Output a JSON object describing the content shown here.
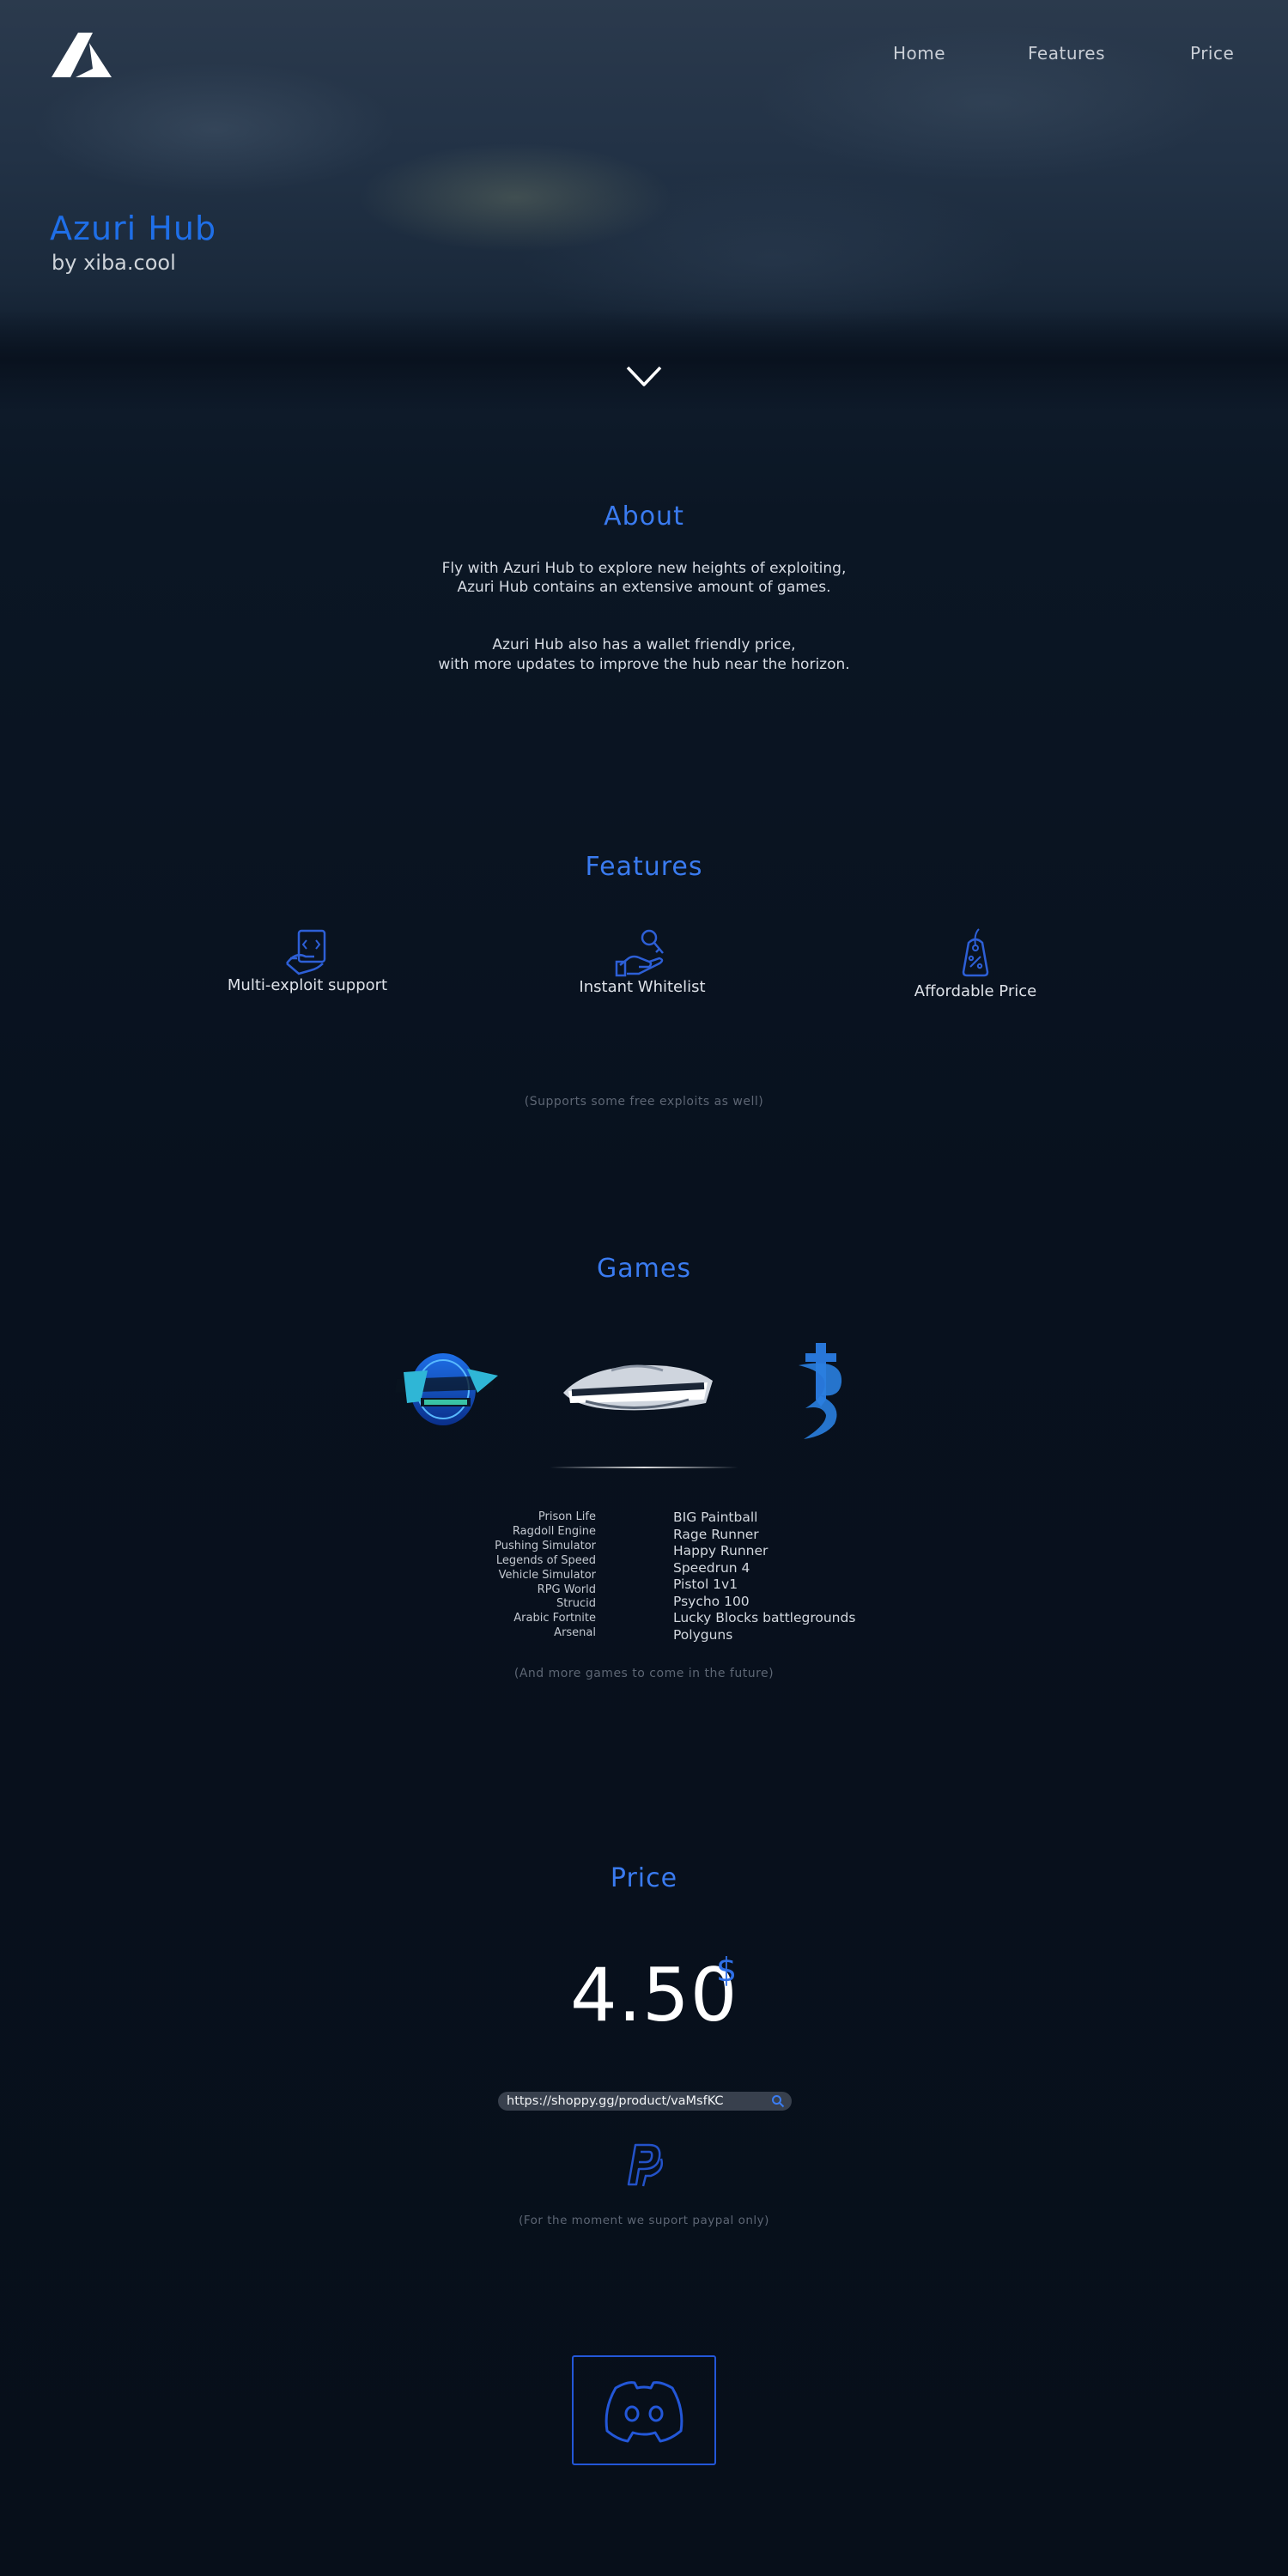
{
  "nav": {
    "items": [
      {
        "label": "Home"
      },
      {
        "label": "Features"
      },
      {
        "label": "Price"
      }
    ]
  },
  "hero": {
    "title": "Azuri Hub",
    "subtitle": "by xiba.cool"
  },
  "about": {
    "title": "About",
    "paragraph1_line1": "Fly with Azuri Hub to explore new heights of exploiting,",
    "paragraph1_line2": "Azuri Hub contains an extensive amount of games.",
    "paragraph2_line1": "Azuri Hub also has a wallet friendly price,",
    "paragraph2_line2": "with more updates to improve the hub near the horizon."
  },
  "features": {
    "title": "Features",
    "items": [
      {
        "label": "Multi-exploit support",
        "icon": "code-document-icon"
      },
      {
        "label": "Instant Whitelist",
        "icon": "hand-key-icon"
      },
      {
        "label": "Affordable Price",
        "icon": "price-tag-icon"
      }
    ],
    "note": "(Supports some free exploits as well)"
  },
  "games": {
    "title": "Games",
    "logos": [
      "jailbreak-logo",
      "bad-business-logo",
      "sword-logo"
    ],
    "left_list": [
      "Prison Life",
      "Ragdoll Engine",
      "Pushing Simulator",
      "Legends of Speed",
      "Vehicle Simulator",
      "RPG World",
      "Strucid",
      "Arabic Fortnite",
      "Arsenal"
    ],
    "right_list": [
      "BIG Paintball",
      "Rage Runner",
      "Happy Runner",
      "Speedrun 4",
      "Pistol 1v1",
      "Psycho 100",
      "Lucky Blocks battlegrounds",
      "Polyguns"
    ],
    "note": "(And more games to come in the future)"
  },
  "price": {
    "title": "Price",
    "amount": "4.50",
    "currency": "$",
    "url": "https://shoppy.gg/product/vaMsfKC",
    "payment_icon": "paypal-icon",
    "note": "(For the moment we suport paypal only)"
  },
  "footer": {
    "discord_icon": "discord-icon"
  },
  "colors": {
    "accent": "#2f6fe6",
    "background": "#07101d",
    "text": "#d8dde6"
  }
}
